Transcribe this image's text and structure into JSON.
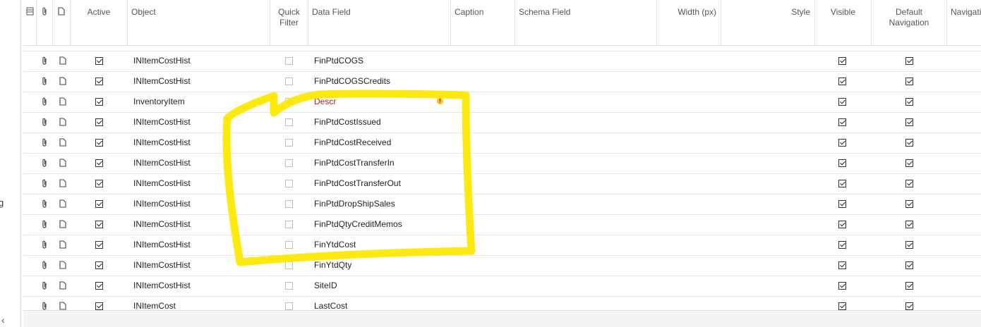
{
  "left_panel": {
    "cut_text": "g",
    "collapse_glyph": "‹"
  },
  "columns": {
    "active": "Active",
    "object": "Object",
    "quick_filter_line1": "Quick",
    "quick_filter_line2": "Filter",
    "data_field": "Data Field",
    "caption": "Caption",
    "schema_field": "Schema Field",
    "width": "Width (px)",
    "style": "Style",
    "visible": "Visible",
    "default_nav_line1": "Default",
    "default_nav_line2": "Navigation",
    "navigation": "Navigati"
  },
  "rows": [
    {
      "active": true,
      "object": "INItemCostHist",
      "quick_filter": false,
      "data_field": "FinPtdCOGS",
      "visible": true,
      "default_navigation": true,
      "error": false
    },
    {
      "active": true,
      "object": "INItemCostHist",
      "quick_filter": false,
      "data_field": "FinPtdCOGSCredits",
      "visible": true,
      "default_navigation": true,
      "error": false
    },
    {
      "active": true,
      "object": "InventoryItem",
      "quick_filter": false,
      "data_field": "Descr",
      "visible": true,
      "default_navigation": true,
      "error": true
    },
    {
      "active": true,
      "object": "INItemCostHist",
      "quick_filter": false,
      "data_field": "FinPtdCostIssued",
      "visible": true,
      "default_navigation": true,
      "error": false
    },
    {
      "active": true,
      "object": "INItemCostHist",
      "quick_filter": false,
      "data_field": "FinPtdCostReceived",
      "visible": true,
      "default_navigation": true,
      "error": false
    },
    {
      "active": true,
      "object": "INItemCostHist",
      "quick_filter": false,
      "data_field": "FinPtdCostTransferIn",
      "visible": true,
      "default_navigation": true,
      "error": false
    },
    {
      "active": true,
      "object": "INItemCostHist",
      "quick_filter": false,
      "data_field": "FinPtdCostTransferOut",
      "visible": true,
      "default_navigation": true,
      "error": false
    },
    {
      "active": true,
      "object": "INItemCostHist",
      "quick_filter": false,
      "data_field": "FinPtdDropShipSales",
      "visible": true,
      "default_navigation": true,
      "error": false
    },
    {
      "active": true,
      "object": "INItemCostHist",
      "quick_filter": false,
      "data_field": "FinPtdQtyCreditMemos",
      "visible": true,
      "default_navigation": true,
      "error": false
    },
    {
      "active": true,
      "object": "INItemCostHist",
      "quick_filter": false,
      "data_field": "FinYtdCost",
      "visible": true,
      "default_navigation": true,
      "error": false
    },
    {
      "active": true,
      "object": "INItemCostHist",
      "quick_filter": false,
      "data_field": "FinYtdQty",
      "visible": true,
      "default_navigation": true,
      "error": false
    },
    {
      "active": true,
      "object": "INItemCostHist",
      "quick_filter": false,
      "data_field": "SiteID",
      "visible": true,
      "default_navigation": true,
      "error": false
    },
    {
      "active": true,
      "object": "INItemCost",
      "quick_filter": false,
      "data_field": "LastCost",
      "visible": true,
      "default_navigation": true,
      "error": false
    }
  ],
  "colors": {
    "highlight": "#fde910",
    "error_text": "#b22222",
    "header_text": "#555555"
  },
  "icons": [
    "grid-settings-icon",
    "attachment-icon",
    "note-icon",
    "error-icon"
  ]
}
